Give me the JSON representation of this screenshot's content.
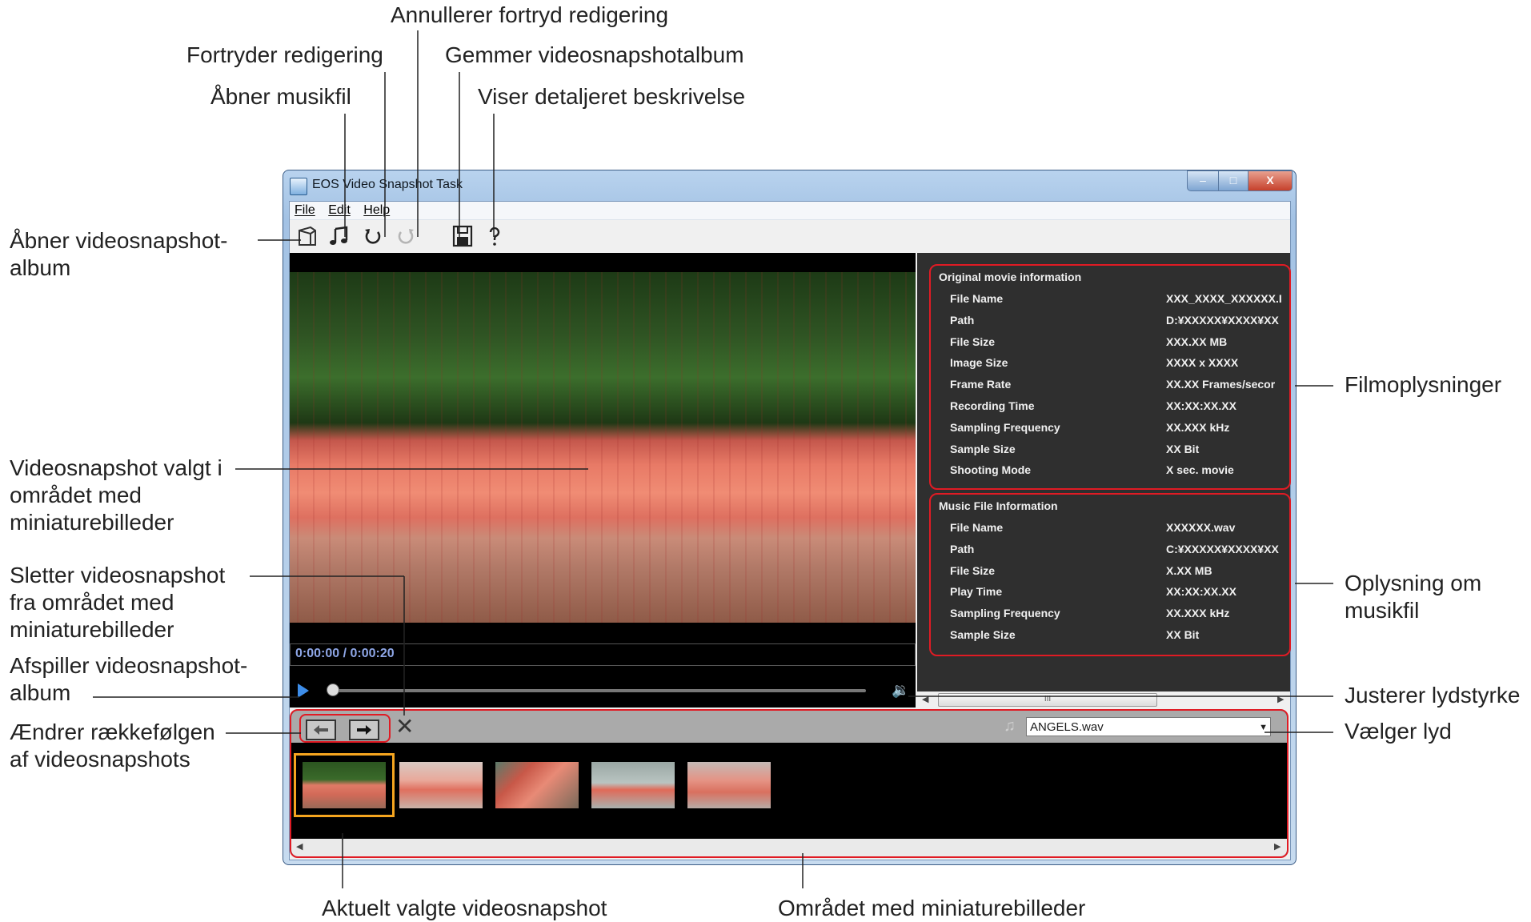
{
  "callouts": {
    "cancel_undo": "Annullerer fortryd redigering",
    "undo": "Fortryder redigering",
    "save_album": "Gemmer videosnapshotalbum",
    "open_music": "Åbner musikfil",
    "show_help": "Viser detaljeret beskrivelse",
    "open_album_1": "Åbner videosnapshot-",
    "open_album_2": "album",
    "selected_1": "Videosnapshot valgt i",
    "selected_2": "området med",
    "selected_3": "miniaturebilleder",
    "delete_1": "Sletter videosnapshot",
    "delete_2": "fra området med",
    "delete_3": "miniaturebilleder",
    "play_1": "Afspiller videosnapshot-",
    "play_2": "album",
    "order_1": "Ændrer rækkefølgen",
    "order_2": "af videosnapshots",
    "movie_info": "Filmoplysninger",
    "music_info_1": "Oplysning om",
    "music_info_2": "musikfil",
    "volume": "Justerer lydstyrke",
    "select_sound": "Vælger lyd",
    "current_selected": "Aktuelt valgte videosnapshot",
    "thumb_area": "Området med miniaturebilleder"
  },
  "window": {
    "title": "EOS Video Snapshot Task",
    "min": "–",
    "max": "□",
    "close": "X"
  },
  "menu": [
    "File",
    "Edit",
    "Help"
  ],
  "toolbar_icons": [
    "album-icon",
    "music-note-icon",
    "undo-icon",
    "redo-icon",
    "save-icon",
    "help-icon"
  ],
  "player": {
    "time": "0:00:00 / 0:00:20",
    "volume_icon": "🔉",
    "progress": 0
  },
  "movie_info": {
    "title": "Original movie information",
    "rows": [
      {
        "k": "File Name",
        "v": "XXX_XXXX_XXXXXX.I"
      },
      {
        "k": "Path",
        "v": "D:¥XXXXX¥XXXX¥XX"
      },
      {
        "k": "File Size",
        "v": "XXX.XX MB"
      },
      {
        "k": "Image Size",
        "v": "XXXX x XXXX"
      },
      {
        "k": "Frame Rate",
        "v": "XX.XX Frames/secor"
      },
      {
        "k": "Recording Time",
        "v": "XX:XX:XX.XX"
      },
      {
        "k": "Sampling Frequency",
        "v": "XX.XXX kHz"
      },
      {
        "k": "Sample Size",
        "v": "XX Bit"
      },
      {
        "k": "Shooting Mode",
        "v": "X sec. movie"
      }
    ]
  },
  "music_info": {
    "title": "Music File Information",
    "rows": [
      {
        "k": "File Name",
        "v": "XXXXXX.wav"
      },
      {
        "k": "Path",
        "v": "C:¥XXXXX¥XXXX¥XX"
      },
      {
        "k": "File Size",
        "v": "X.XX MB"
      },
      {
        "k": "Play Time",
        "v": "XX:XX:XX.XX"
      },
      {
        "k": "Sampling Frequency",
        "v": "XX.XXX kHz"
      },
      {
        "k": "Sample Size",
        "v": "XX Bit"
      }
    ]
  },
  "scroll_grip": "III",
  "sound": {
    "selected": "ANGELS.wav",
    "note_icon": "♫"
  },
  "delete_glyph": "✕",
  "thumbnails": [
    "thumb-1",
    "thumb-2",
    "thumb-3",
    "thumb-4",
    "thumb-5"
  ],
  "colors": {
    "highlight": "#e01b24",
    "selection": "#f5a51f",
    "time_text": "#8ea6e6"
  }
}
